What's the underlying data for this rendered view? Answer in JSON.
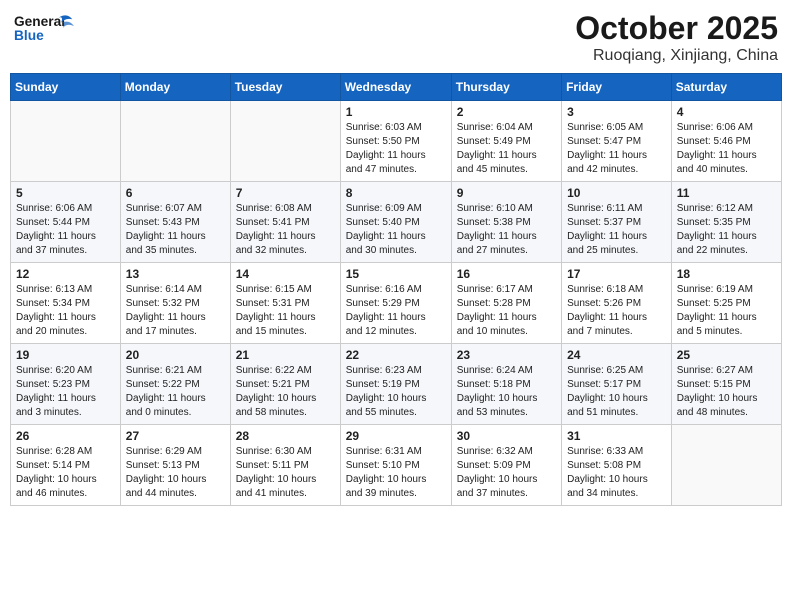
{
  "header": {
    "logo_line1": "General",
    "logo_line2": "Blue",
    "month": "October 2025",
    "location": "Ruoqiang, Xinjiang, China"
  },
  "weekdays": [
    "Sunday",
    "Monday",
    "Tuesday",
    "Wednesday",
    "Thursday",
    "Friday",
    "Saturday"
  ],
  "weeks": [
    [
      {
        "day": "",
        "info": ""
      },
      {
        "day": "",
        "info": ""
      },
      {
        "day": "",
        "info": ""
      },
      {
        "day": "1",
        "info": "Sunrise: 6:03 AM\nSunset: 5:50 PM\nDaylight: 11 hours\nand 47 minutes."
      },
      {
        "day": "2",
        "info": "Sunrise: 6:04 AM\nSunset: 5:49 PM\nDaylight: 11 hours\nand 45 minutes."
      },
      {
        "day": "3",
        "info": "Sunrise: 6:05 AM\nSunset: 5:47 PM\nDaylight: 11 hours\nand 42 minutes."
      },
      {
        "day": "4",
        "info": "Sunrise: 6:06 AM\nSunset: 5:46 PM\nDaylight: 11 hours\nand 40 minutes."
      }
    ],
    [
      {
        "day": "5",
        "info": "Sunrise: 6:06 AM\nSunset: 5:44 PM\nDaylight: 11 hours\nand 37 minutes."
      },
      {
        "day": "6",
        "info": "Sunrise: 6:07 AM\nSunset: 5:43 PM\nDaylight: 11 hours\nand 35 minutes."
      },
      {
        "day": "7",
        "info": "Sunrise: 6:08 AM\nSunset: 5:41 PM\nDaylight: 11 hours\nand 32 minutes."
      },
      {
        "day": "8",
        "info": "Sunrise: 6:09 AM\nSunset: 5:40 PM\nDaylight: 11 hours\nand 30 minutes."
      },
      {
        "day": "9",
        "info": "Sunrise: 6:10 AM\nSunset: 5:38 PM\nDaylight: 11 hours\nand 27 minutes."
      },
      {
        "day": "10",
        "info": "Sunrise: 6:11 AM\nSunset: 5:37 PM\nDaylight: 11 hours\nand 25 minutes."
      },
      {
        "day": "11",
        "info": "Sunrise: 6:12 AM\nSunset: 5:35 PM\nDaylight: 11 hours\nand 22 minutes."
      }
    ],
    [
      {
        "day": "12",
        "info": "Sunrise: 6:13 AM\nSunset: 5:34 PM\nDaylight: 11 hours\nand 20 minutes."
      },
      {
        "day": "13",
        "info": "Sunrise: 6:14 AM\nSunset: 5:32 PM\nDaylight: 11 hours\nand 17 minutes."
      },
      {
        "day": "14",
        "info": "Sunrise: 6:15 AM\nSunset: 5:31 PM\nDaylight: 11 hours\nand 15 minutes."
      },
      {
        "day": "15",
        "info": "Sunrise: 6:16 AM\nSunset: 5:29 PM\nDaylight: 11 hours\nand 12 minutes."
      },
      {
        "day": "16",
        "info": "Sunrise: 6:17 AM\nSunset: 5:28 PM\nDaylight: 11 hours\nand 10 minutes."
      },
      {
        "day": "17",
        "info": "Sunrise: 6:18 AM\nSunset: 5:26 PM\nDaylight: 11 hours\nand 7 minutes."
      },
      {
        "day": "18",
        "info": "Sunrise: 6:19 AM\nSunset: 5:25 PM\nDaylight: 11 hours\nand 5 minutes."
      }
    ],
    [
      {
        "day": "19",
        "info": "Sunrise: 6:20 AM\nSunset: 5:23 PM\nDaylight: 11 hours\nand 3 minutes."
      },
      {
        "day": "20",
        "info": "Sunrise: 6:21 AM\nSunset: 5:22 PM\nDaylight: 11 hours\nand 0 minutes."
      },
      {
        "day": "21",
        "info": "Sunrise: 6:22 AM\nSunset: 5:21 PM\nDaylight: 10 hours\nand 58 minutes."
      },
      {
        "day": "22",
        "info": "Sunrise: 6:23 AM\nSunset: 5:19 PM\nDaylight: 10 hours\nand 55 minutes."
      },
      {
        "day": "23",
        "info": "Sunrise: 6:24 AM\nSunset: 5:18 PM\nDaylight: 10 hours\nand 53 minutes."
      },
      {
        "day": "24",
        "info": "Sunrise: 6:25 AM\nSunset: 5:17 PM\nDaylight: 10 hours\nand 51 minutes."
      },
      {
        "day": "25",
        "info": "Sunrise: 6:27 AM\nSunset: 5:15 PM\nDaylight: 10 hours\nand 48 minutes."
      }
    ],
    [
      {
        "day": "26",
        "info": "Sunrise: 6:28 AM\nSunset: 5:14 PM\nDaylight: 10 hours\nand 46 minutes."
      },
      {
        "day": "27",
        "info": "Sunrise: 6:29 AM\nSunset: 5:13 PM\nDaylight: 10 hours\nand 44 minutes."
      },
      {
        "day": "28",
        "info": "Sunrise: 6:30 AM\nSunset: 5:11 PM\nDaylight: 10 hours\nand 41 minutes."
      },
      {
        "day": "29",
        "info": "Sunrise: 6:31 AM\nSunset: 5:10 PM\nDaylight: 10 hours\nand 39 minutes."
      },
      {
        "day": "30",
        "info": "Sunrise: 6:32 AM\nSunset: 5:09 PM\nDaylight: 10 hours\nand 37 minutes."
      },
      {
        "day": "31",
        "info": "Sunrise: 6:33 AM\nSunset: 5:08 PM\nDaylight: 10 hours\nand 34 minutes."
      },
      {
        "day": "",
        "info": ""
      }
    ]
  ]
}
